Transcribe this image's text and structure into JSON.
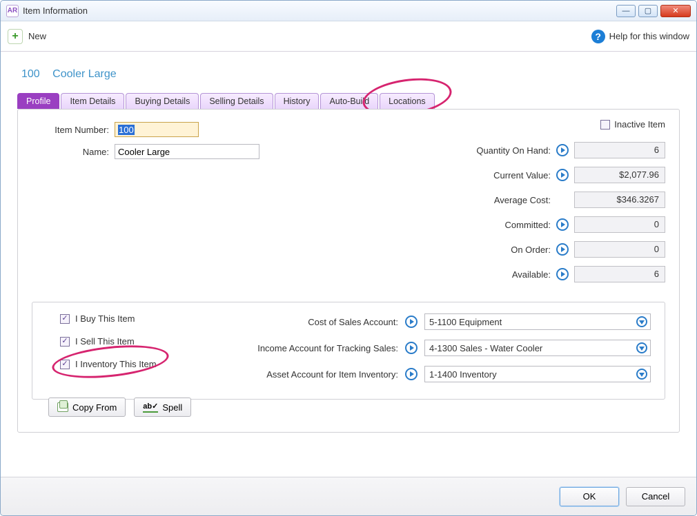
{
  "window": {
    "title": "Item Information",
    "app_icon": "AR"
  },
  "toolbar": {
    "new_label": "New",
    "help_label": "Help for this window"
  },
  "header": {
    "item_number": "100",
    "item_name": "Cooler Large"
  },
  "tabs": [
    "Profile",
    "Item Details",
    "Buying Details",
    "Selling Details",
    "History",
    "Auto-Build",
    "Locations"
  ],
  "fields": {
    "item_number_label": "Item Number:",
    "item_number_value": "100",
    "name_label": "Name:",
    "name_value": "Cooler Large",
    "inactive_label": "Inactive Item"
  },
  "stats": {
    "qty_on_hand": {
      "label": "Quantity On Hand:",
      "value": "6"
    },
    "current_value": {
      "label": "Current Value:",
      "value": "$2,077.96"
    },
    "avg_cost": {
      "label": "Average Cost:",
      "value": "$346.3267"
    },
    "committed": {
      "label": "Committed:",
      "value": "0"
    },
    "on_order": {
      "label": "On Order:",
      "value": "0"
    },
    "available": {
      "label": "Available:",
      "value": "6"
    }
  },
  "checks": {
    "buy": "I Buy This Item",
    "sell": "I Sell This Item",
    "inventory": "I Inventory This Item"
  },
  "accounts": {
    "cogs": {
      "label": "Cost of Sales Account:",
      "value": "5-1100 Equipment"
    },
    "income": {
      "label": "Income Account for Tracking Sales:",
      "value": "4-1300 Sales - Water Cooler"
    },
    "asset": {
      "label": "Asset Account for Item Inventory:",
      "value": "1-1400 Inventory"
    }
  },
  "buttons": {
    "copy_from": "Copy From",
    "spell": "Spell",
    "ok": "OK",
    "cancel": "Cancel"
  }
}
